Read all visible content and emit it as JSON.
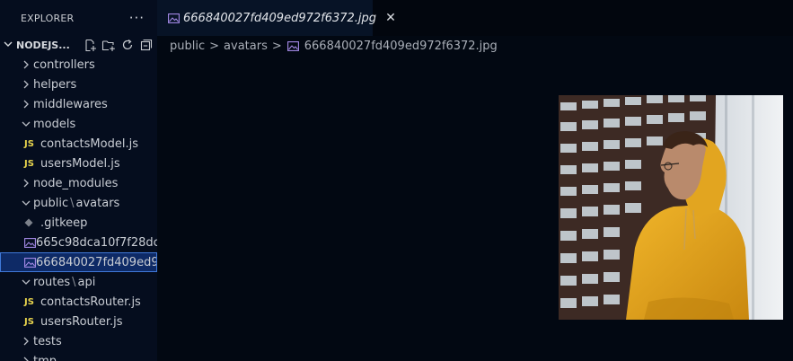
{
  "explorer": {
    "title": "EXPLORER",
    "more_label": "···",
    "project": "NODEJS..."
  },
  "tree": [
    {
      "label": "controllers",
      "kind": "folder",
      "expanded": false
    },
    {
      "label": "helpers",
      "kind": "folder",
      "expanded": false
    },
    {
      "label": "middlewares",
      "kind": "folder",
      "expanded": false
    },
    {
      "label": "models",
      "kind": "folder",
      "expanded": true
    },
    {
      "label": "contactsModel.js",
      "kind": "js"
    },
    {
      "label": "usersModel.js",
      "kind": "js"
    },
    {
      "label": "node_modules",
      "kind": "folder",
      "expanded": false
    },
    {
      "label_a": "public",
      "label_b": "avatars",
      "kind": "folder-compact",
      "expanded": true
    },
    {
      "label": ".gitkeep",
      "kind": "git"
    },
    {
      "label": "665c98dca10f7f28dc...",
      "kind": "image"
    },
    {
      "label": "666840027fd409ed9...",
      "kind": "image",
      "selected": true
    },
    {
      "label_a": "routes",
      "label_b": "api",
      "kind": "folder-compact",
      "expanded": true
    },
    {
      "label": "contactsRouter.js",
      "kind": "js"
    },
    {
      "label": "usersRouter.js",
      "kind": "js"
    },
    {
      "label": "tests",
      "kind": "folder",
      "expanded": false
    },
    {
      "label": "tmp",
      "kind": "folder",
      "expanded": false
    }
  ],
  "js_badge": "JS",
  "tab": {
    "title": "666840027fd409ed972f6372.jpg",
    "close": "✕"
  },
  "breadcrumb": {
    "part1": "public",
    "part2": "avatars",
    "file": "666840027fd409ed972f6372.jpg",
    "sep": ">"
  },
  "colors": {
    "sidebar_bg": "#050d1e",
    "editor_bg": "#020812",
    "selected_bg": "#0e2a66",
    "image_icon": "#a58be8",
    "hoodie": "#e3a41c"
  }
}
